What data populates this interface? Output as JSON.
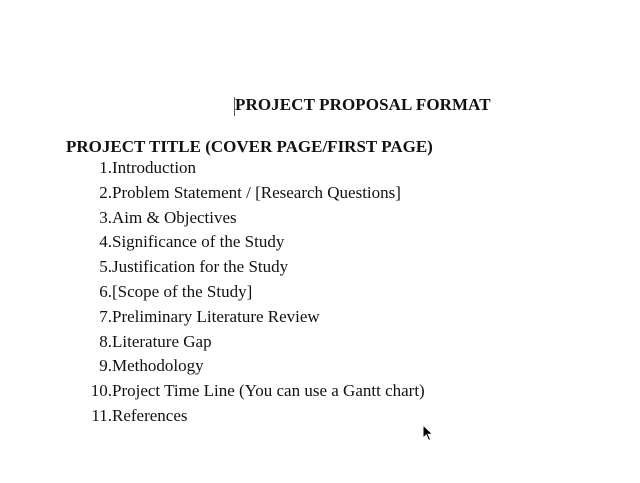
{
  "document": {
    "title": "PROJECT PROPOSAL FORMAT",
    "section_title": "PROJECT TITLE (COVER PAGE/FIRST PAGE)",
    "items": [
      {
        "num": "1.",
        "text": "Introduction"
      },
      {
        "num": "2.",
        "text": "Problem Statement / [Research Questions]"
      },
      {
        "num": "3.",
        "text": "Aim & Objectives"
      },
      {
        "num": "4.",
        "text": "Significance of the Study"
      },
      {
        "num": "5.",
        "text": "Justification for the Study"
      },
      {
        "num": "6.",
        "text": "[Scope of the Study]"
      },
      {
        "num": "7.",
        "text": "Preliminary Literature Review"
      },
      {
        "num": "8.",
        "text": "Literature Gap"
      },
      {
        "num": "9.",
        "text": "Methodology"
      },
      {
        "num": "10.",
        "text": "Project Time Line (You can use a Gantt chart)"
      },
      {
        "num": "11.",
        "text": "References"
      }
    ]
  },
  "icons": {
    "cursor": "mouse-pointer-icon"
  }
}
